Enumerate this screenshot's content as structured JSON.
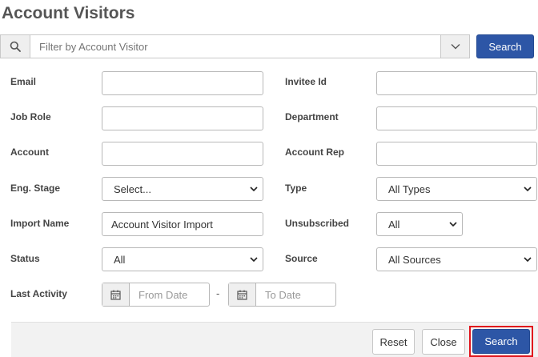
{
  "page": {
    "title": "Account Visitors"
  },
  "search": {
    "placeholder": "Filter by Account Visitor",
    "button_label": "Search"
  },
  "form": {
    "email_label": "Email",
    "invitee_id_label": "Invitee Id",
    "job_role_label": "Job Role",
    "department_label": "Department",
    "account_label": "Account",
    "account_rep_label": "Account Rep",
    "eng_stage_label": "Eng. Stage",
    "eng_stage_value": "Select...",
    "type_label": "Type",
    "type_value": "All Types",
    "import_name_label": "Import Name",
    "import_name_value": "Account Visitor Import",
    "unsubscribed_label": "Unsubscribed",
    "unsubscribed_value": "All",
    "status_label": "Status",
    "status_value": "All",
    "source_label": "Source",
    "source_value": "All Sources",
    "last_activity_label": "Last Activity",
    "from_date_placeholder": "From Date",
    "date_separator": "-",
    "to_date_placeholder": "To Date"
  },
  "footer": {
    "reset_label": "Reset",
    "close_label": "Close",
    "search_label": "Search"
  },
  "colors": {
    "primary": "#2d56a6",
    "focus_outline": "#e0141c",
    "footer_bg": "#f2f2f2"
  }
}
